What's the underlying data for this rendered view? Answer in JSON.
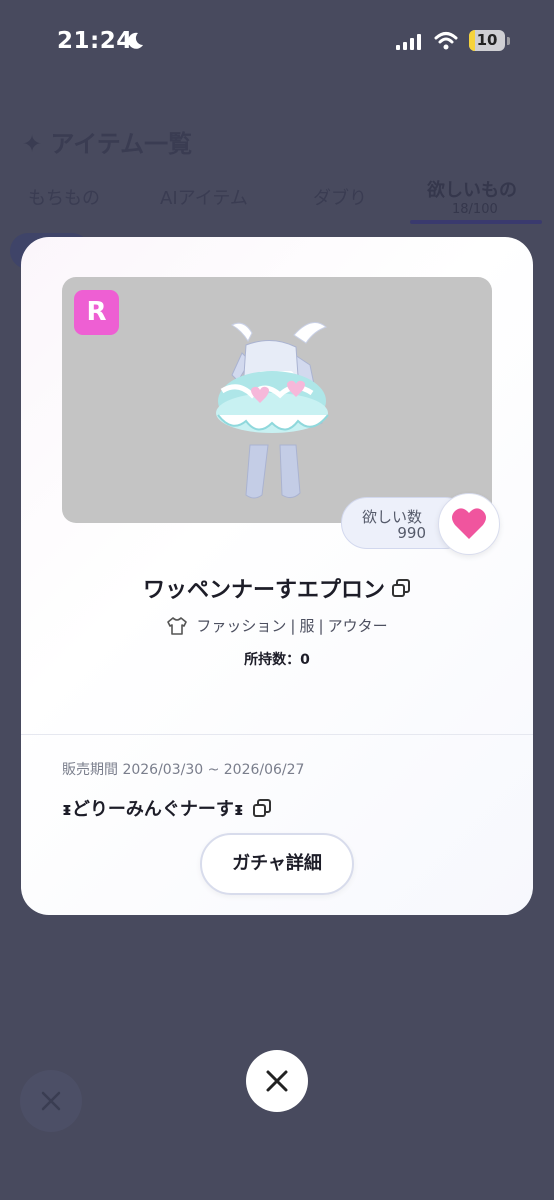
{
  "status_bar": {
    "time": "21:24",
    "battery": "10"
  },
  "background": {
    "title": "✦ アイテム一覧",
    "tabs": [
      {
        "label": "もちもの"
      },
      {
        "label": "AIアイテム"
      },
      {
        "label": "ダブり"
      },
      {
        "label": "欲しいもの",
        "count": "18/100"
      }
    ]
  },
  "item": {
    "rarity": "R",
    "want_label": "欲しい数",
    "want_count": "990",
    "name": "ワッペンナーすエプロン",
    "category": {
      "parts": [
        "ファッション",
        "|",
        "服",
        "|",
        "アウター"
      ]
    },
    "owned": "所持数：0",
    "sale_period": "販売期間 2026/03/30 ~ 2026/06/27",
    "gacha_name": "ᵻどりーみんぐナーすᵻ",
    "gacha_button": "ガチャ詳細"
  },
  "colors": {
    "overlay": "#484a5e",
    "rarity": "#ee5fd3",
    "heart": "#f0559e"
  }
}
